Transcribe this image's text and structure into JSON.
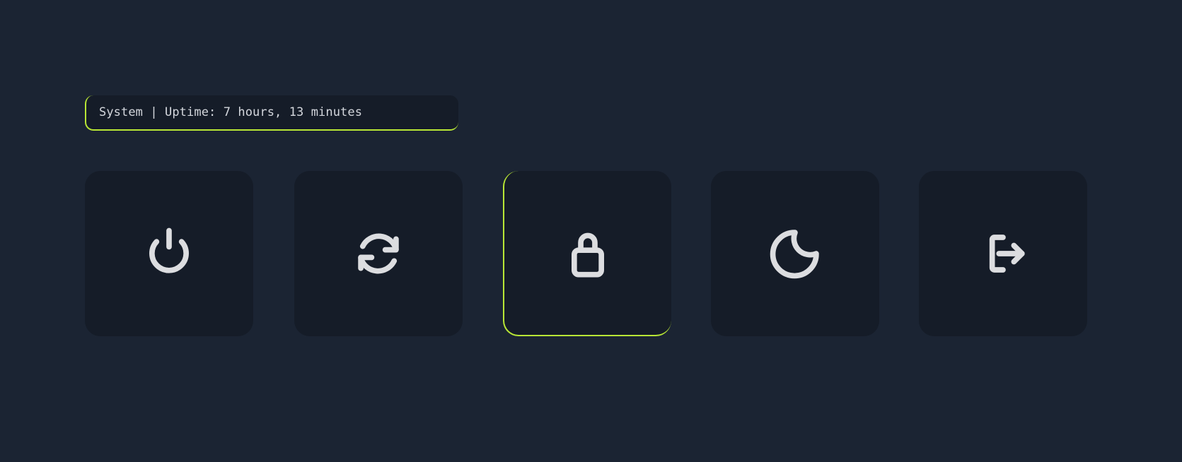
{
  "status": {
    "text": "System | Uptime: 7 hours, 13 minutes"
  },
  "actions": [
    {
      "id": "shutdown",
      "icon": "power-icon",
      "selected": false
    },
    {
      "id": "reboot",
      "icon": "refresh-icon",
      "selected": false
    },
    {
      "id": "lock",
      "icon": "lock-icon",
      "selected": true
    },
    {
      "id": "suspend",
      "icon": "moon-icon",
      "selected": false
    },
    {
      "id": "logout",
      "icon": "logout-icon",
      "selected": false
    }
  ],
  "colors": {
    "background": "#1b2433",
    "tile": "#151c28",
    "accent": "#b8e635",
    "icon": "#dcdde0"
  }
}
